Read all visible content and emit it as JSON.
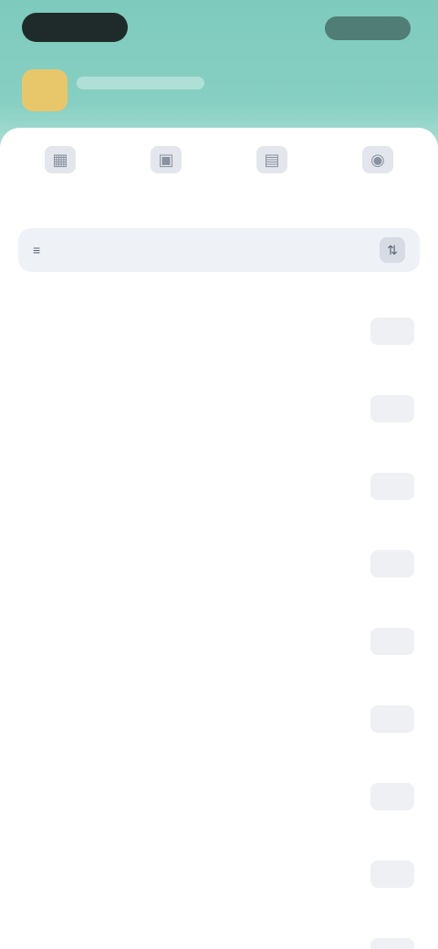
{
  "quick_actions": [
    {
      "icon": "grid-icon",
      "glyph": "▦",
      "label": ""
    },
    {
      "icon": "box-icon",
      "glyph": "▣",
      "label": ""
    },
    {
      "icon": "chart-icon",
      "glyph": "▤",
      "label": ""
    },
    {
      "icon": "user-icon",
      "glyph": "◉",
      "label": ""
    }
  ],
  "filter": {
    "icon_glyph": "≡",
    "label": "",
    "action_glyph": "⇅"
  },
  "list_items": [
    {
      "title": "",
      "subtitle": "",
      "meta": "",
      "side": ""
    },
    {
      "title": "",
      "subtitle": "",
      "meta": "",
      "side": ""
    },
    {
      "title": "",
      "subtitle": "",
      "meta": "",
      "side": ""
    },
    {
      "title": "",
      "subtitle": "",
      "meta": "",
      "side": ""
    },
    {
      "title": "",
      "subtitle": "",
      "meta": "",
      "side": ""
    },
    {
      "title": "",
      "subtitle": "",
      "meta": "",
      "side": ""
    },
    {
      "title": "",
      "subtitle": "",
      "meta": "",
      "side": ""
    },
    {
      "title": "",
      "subtitle": "",
      "meta": "",
      "side": ""
    },
    {
      "title": "",
      "subtitle": "",
      "meta": "",
      "side": ""
    }
  ],
  "colors": {
    "header_teal": "#7ecbbd",
    "avatar_yellow": "#e8c76a",
    "filter_bg": "#eef1f6"
  }
}
